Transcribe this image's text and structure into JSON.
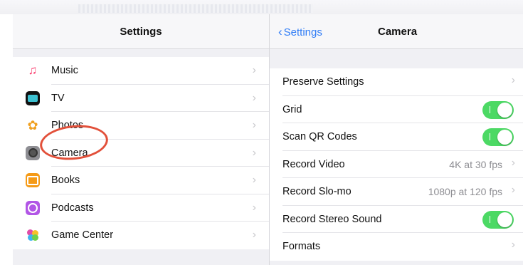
{
  "left_pane": {
    "title": "Settings",
    "items": [
      {
        "label": "Music",
        "icon": "music-note-icon",
        "color": "#ffffff",
        "glyph": "♫",
        "glyph_color": "#fa3f70"
      },
      {
        "label": "TV",
        "icon": "tv-icon",
        "color": "#111111",
        "glyph": "",
        "glyph_color": "#3cc0d0"
      },
      {
        "label": "Photos",
        "icon": "photos-flower-icon",
        "color": "#ffffff",
        "glyph": "✿",
        "glyph_color": "#f0a020"
      },
      {
        "label": "Camera",
        "icon": "camera-icon",
        "color": "#8e8e93",
        "glyph": "◉",
        "glyph_color": "#ffffff"
      },
      {
        "label": "Books",
        "icon": "books-icon",
        "color": "#f59a16",
        "glyph": "▤",
        "glyph_color": "#ffffff"
      },
      {
        "label": "Podcasts",
        "icon": "podcasts-icon",
        "color": "#b256e6",
        "glyph": "◎",
        "glyph_color": "#ffffff"
      },
      {
        "label": "Game Center",
        "icon": "game-center-icon",
        "color": "#ffffff",
        "glyph": "●",
        "glyph_color": "#e04da8"
      }
    ],
    "chevron": "›"
  },
  "right_pane": {
    "back_label": "Settings",
    "title": "Camera",
    "rows": [
      {
        "label": "Preserve Settings",
        "type": "chevron"
      },
      {
        "label": "Grid",
        "type": "toggle",
        "on": true
      },
      {
        "label": "Scan QR Codes",
        "type": "toggle",
        "on": true
      },
      {
        "label": "Record Video",
        "type": "value",
        "value": "4K at 30 fps"
      },
      {
        "label": "Record Slo-mo",
        "type": "value",
        "value": "1080p at 120 fps"
      },
      {
        "label": "Record Stereo Sound",
        "type": "toggle",
        "on": true
      },
      {
        "label": "Formats",
        "type": "chevron"
      }
    ],
    "chevron": "›"
  },
  "annotation": {
    "highlight": "Camera",
    "color": "#e2503a"
  },
  "colors": {
    "accent": "#2f7cf6",
    "toggle_on": "#4cd964"
  }
}
